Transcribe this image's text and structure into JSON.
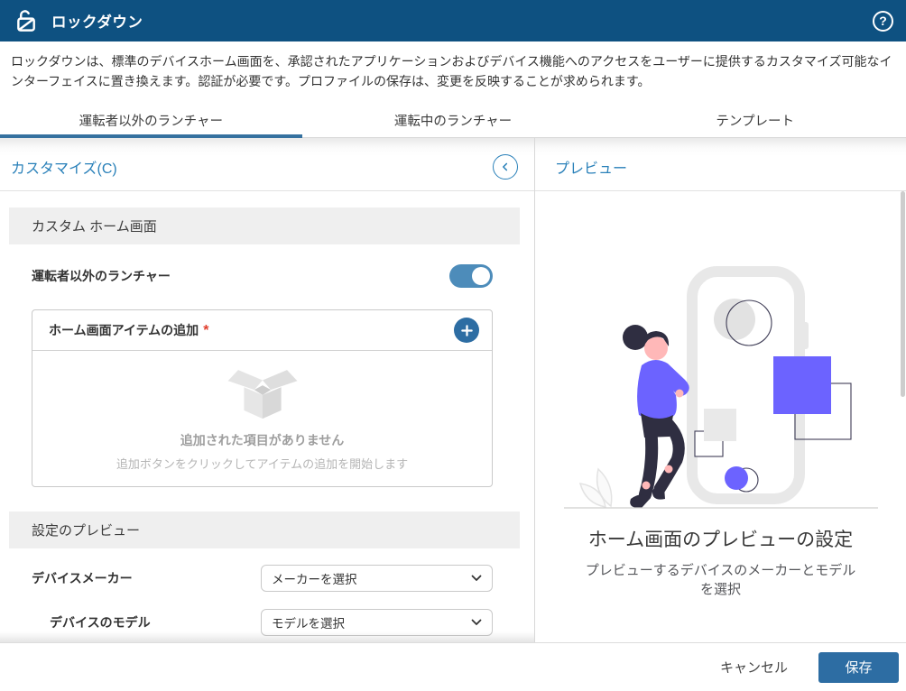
{
  "header": {
    "title": "ロックダウン",
    "help_glyph": "?"
  },
  "description": "ロックダウンは、標準のデバイスホーム画面を、承認されたアプリケーションおよびデバイス機能へのアクセスをユーザーに提供するカスタマイズ可能なインターフェイスに置き換えます。認証が必要です。プロファイルの保存は、変更を反映することが求められます。",
  "tabs": [
    {
      "label": "運転者以外のランチャー",
      "active": true
    },
    {
      "label": "運転中のランチャー",
      "active": false
    },
    {
      "label": "テンプレート",
      "active": false
    }
  ],
  "customize_panel": {
    "title": "カスタマイズ(C)",
    "custom_home": {
      "section_title": "カスタム ホーム画面",
      "toggle_label": "運転者以外のランチャー",
      "toggle_state": "on",
      "add_items": {
        "title": "ホーム画面アイテムの追加",
        "required_mark": "*",
        "empty_title": "追加された項目がありません",
        "empty_subtitle": "追加ボタンをクリックしてアイテムの追加を開始します"
      }
    },
    "settings_preview": {
      "section_title": "設定のプレビュー",
      "manufacturer_label": "デバイスメーカー",
      "manufacturer_value": "メーカーを選択",
      "model_label": "デバイスのモデル",
      "model_value": "モデルを選択"
    }
  },
  "preview_panel": {
    "title": "プレビュー",
    "caption_title": "ホーム画面のプレビューの設定",
    "caption_subtitle": "プレビューするデバイスのメーカーとモデルを選択"
  },
  "footer": {
    "cancel_label": "キャンセル",
    "save_label": "保存"
  },
  "colors": {
    "header_bg": "#0e5181",
    "accent": "#2d6da3",
    "link_blue": "#2980b9",
    "toggle_on": "#4d8cba",
    "required_red": "#e03e2d",
    "illustration_purple": "#6c63ff",
    "illustration_outline": "#3f3d56"
  }
}
